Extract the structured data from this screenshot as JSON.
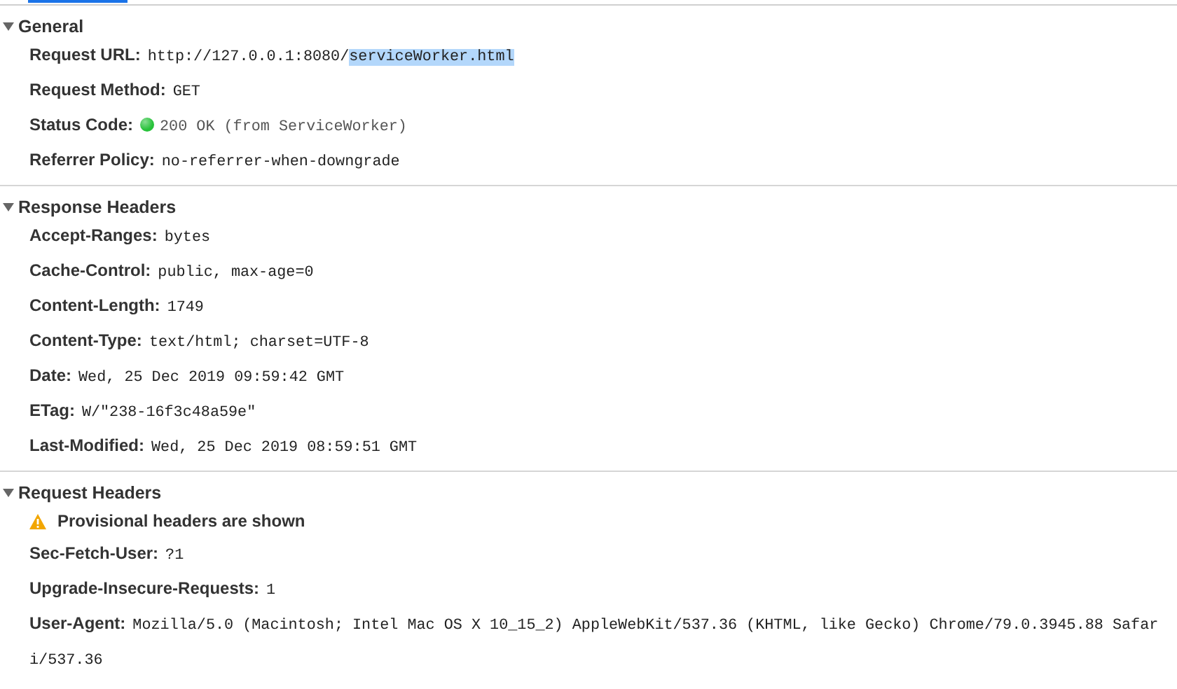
{
  "sections": [
    {
      "title": "General",
      "expanded": true,
      "rows": [
        {
          "kind": "header",
          "name": "Request URL:",
          "value": "http://127.0.0.1:8080/",
          "selected_value": "serviceWorker.html"
        },
        {
          "kind": "header",
          "name": "Request Method:",
          "value": "GET"
        },
        {
          "kind": "status",
          "name": "Status Code:",
          "value": "200 OK (from ServiceWorker)",
          "color": "#27c23a"
        },
        {
          "kind": "header",
          "name": "Referrer Policy:",
          "value": "no-referrer-when-downgrade"
        }
      ]
    },
    {
      "title": "Response Headers",
      "expanded": true,
      "rows": [
        {
          "kind": "header",
          "name": "Accept-Ranges:",
          "value": "bytes"
        },
        {
          "kind": "header",
          "name": "Cache-Control:",
          "value": "public, max-age=0"
        },
        {
          "kind": "header",
          "name": "Content-Length:",
          "value": "1749"
        },
        {
          "kind": "header",
          "name": "Content-Type:",
          "value": "text/html; charset=UTF-8"
        },
        {
          "kind": "header",
          "name": "Date:",
          "value": "Wed, 25 Dec 2019 09:59:42 GMT"
        },
        {
          "kind": "header",
          "name": "ETag:",
          "value": "W/\"238-16f3c48a59e\""
        },
        {
          "kind": "header",
          "name": "Last-Modified:",
          "value": "Wed, 25 Dec 2019 08:59:51 GMT"
        }
      ]
    },
    {
      "title": "Request Headers",
      "expanded": true,
      "rows": [
        {
          "kind": "warning",
          "text": "Provisional headers are shown"
        },
        {
          "kind": "header",
          "name": "Sec-Fetch-User:",
          "value": "?1"
        },
        {
          "kind": "header",
          "name": "Upgrade-Insecure-Requests:",
          "value": "1"
        },
        {
          "kind": "header",
          "name": "User-Agent:",
          "value": "Mozilla/5.0 (Macintosh; Intel Mac OS X 10_15_2) AppleWebKit/537.36 (KHTML, like Gecko) Chrome/79.0.3945.88 Safari/537.36"
        }
      ]
    }
  ]
}
